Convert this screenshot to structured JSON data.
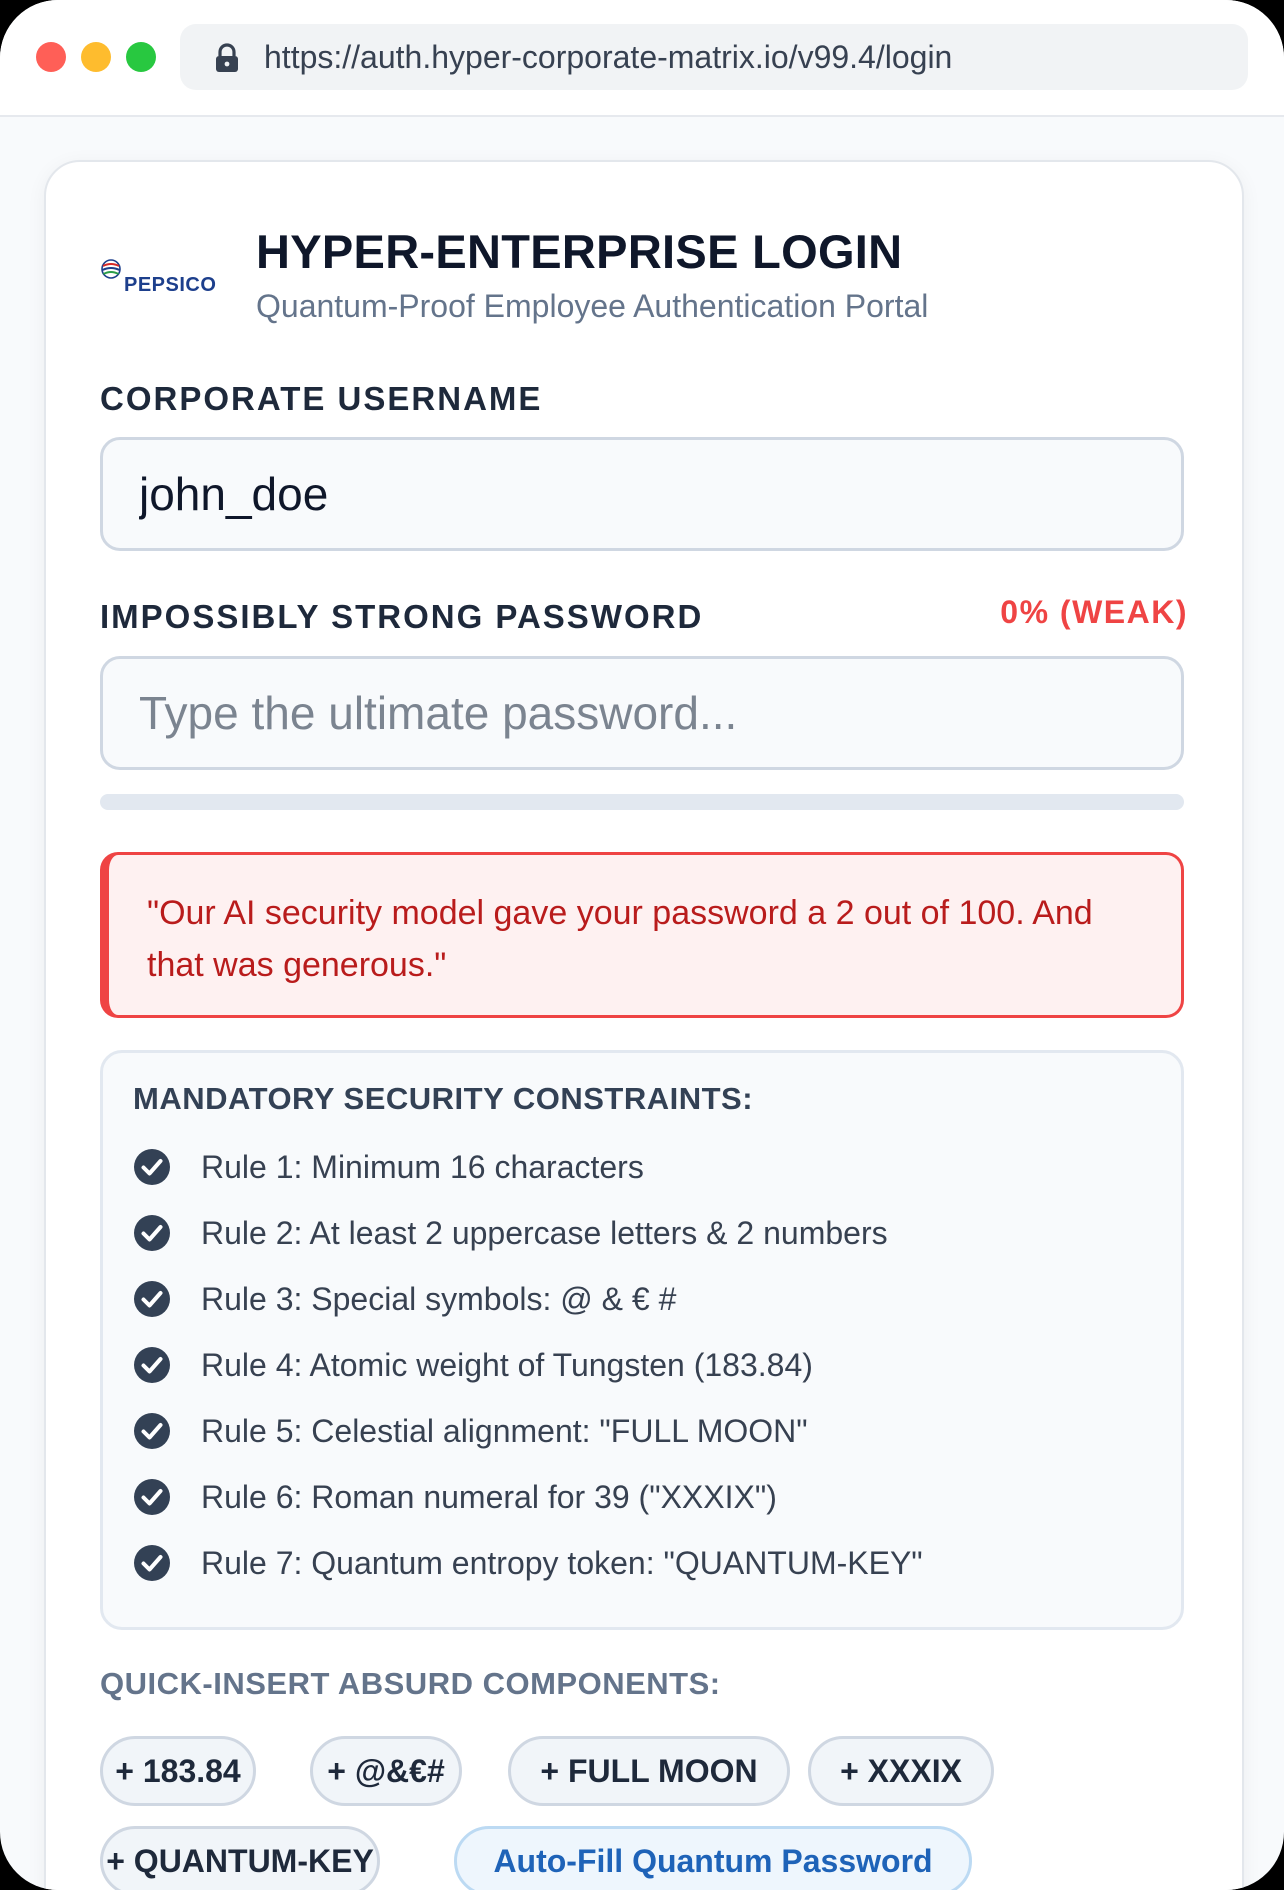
{
  "browser": {
    "url": "https://auth.hyper-corporate-matrix.io/v99.4/login"
  },
  "brand": {
    "logo_text": "PEPSICO"
  },
  "header": {
    "title": "HYPER-ENTERPRISE LOGIN",
    "subtitle": "Quantum-Proof Employee Authentication Portal"
  },
  "username": {
    "label": "CORPORATE USERNAME",
    "value": "john_doe"
  },
  "password": {
    "label": "IMPOSSIBLY STRONG PASSWORD",
    "strength_text": "0% (WEAK)",
    "strength_percent": 0,
    "value": "",
    "placeholder": "Type the ultimate password..."
  },
  "alert": {
    "message": "\"Our AI security model gave your password a 2 out of 100. And that was generous.\""
  },
  "constraints": {
    "title": "MANDATORY SECURITY CONSTRAINTS:",
    "rules": [
      "Rule 1: Minimum 16 characters",
      "Rule 2: At least 2 uppercase letters & 2 numbers",
      "Rule 3: Special symbols: @ & € #",
      "Rule 4: Atomic weight of Tungsten (183.84)",
      "Rule 5: Celestial alignment: \"FULL MOON\"",
      "Rule 6: Roman numeral for 39 (\"XXXIX\")",
      "Rule 7: Quantum entropy token: \"QUANTUM-KEY\""
    ],
    "icon": "check-circle-icon"
  },
  "quick_insert": {
    "title": "QUICK-INSERT ABSURD COMPONENTS:",
    "chips": [
      "+ 183.84",
      "+ @&€#",
      "+ FULL MOON",
      "+ XXXIX",
      "+ QUANTUM-KEY"
    ],
    "autofill_label": "Auto-Fill Quantum Password"
  },
  "colors": {
    "accent_red": "#ef4444",
    "alert_text": "#b91c1c",
    "check_icon": "#334155",
    "autofill_blue": "#1e63b8"
  }
}
